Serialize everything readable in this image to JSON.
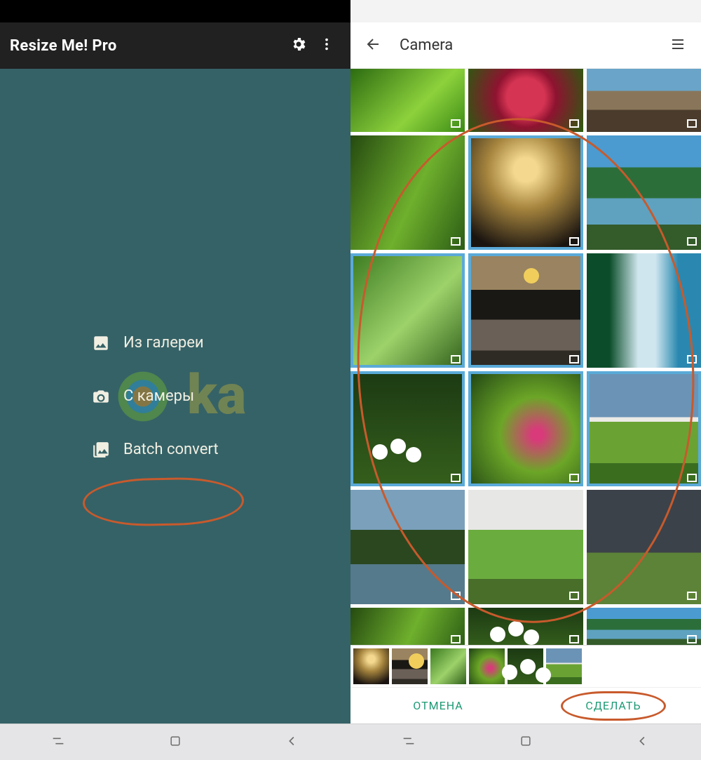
{
  "leftPhone": {
    "appTitle": "Resize Me! Pro",
    "menu": {
      "gallery": "Из галереи",
      "camera": "С камеры",
      "batch": "Batch convert"
    }
  },
  "rightPhone": {
    "galleryTitle": "Camera",
    "grid": [
      {
        "name": "grass",
        "selected": false,
        "partial": "top"
      },
      {
        "name": "raspberry",
        "selected": false,
        "partial": "top"
      },
      {
        "name": "mountains",
        "selected": false,
        "partial": "top"
      },
      {
        "name": "bamboo",
        "selected": false
      },
      {
        "name": "nightpath",
        "selected": true
      },
      {
        "name": "lake",
        "selected": false
      },
      {
        "name": "leaf",
        "selected": true
      },
      {
        "name": "moon",
        "selected": true
      },
      {
        "name": "waterfall",
        "selected": false
      },
      {
        "name": "flowers",
        "selected": true
      },
      {
        "name": "ferns",
        "selected": true
      },
      {
        "name": "field",
        "selected": true
      },
      {
        "name": "riverside",
        "selected": false
      },
      {
        "name": "meadow",
        "selected": false
      },
      {
        "name": "storm",
        "selected": false
      },
      {
        "name": "bamboo",
        "selected": false,
        "partial": "bottom"
      },
      {
        "name": "flowers",
        "selected": false,
        "partial": "bottom"
      },
      {
        "name": "lake",
        "selected": false,
        "partial": "bottom"
      }
    ],
    "selectionStrip": [
      "nightpath",
      "moon",
      "leaf",
      "ferns",
      "flowers",
      "field"
    ],
    "buttons": {
      "cancel": "ОТМЕНА",
      "done": "СДЕЛАТЬ"
    }
  }
}
